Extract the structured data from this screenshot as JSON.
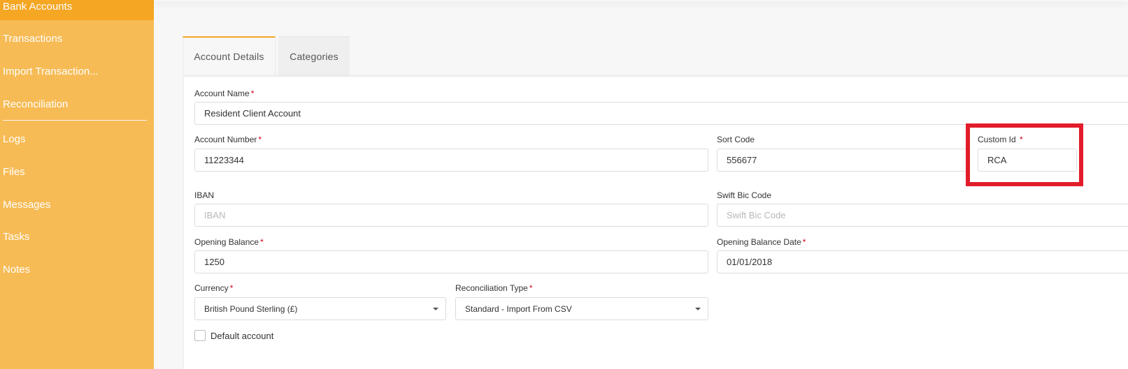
{
  "sidebar": {
    "items": [
      {
        "label": "Bank Accounts"
      },
      {
        "label": "Transactions"
      },
      {
        "label": "Import Transaction..."
      },
      {
        "label": "Reconciliation"
      },
      {
        "label": "Logs"
      },
      {
        "label": "Files"
      },
      {
        "label": "Messages"
      },
      {
        "label": "Tasks"
      },
      {
        "label": "Notes"
      }
    ]
  },
  "tabs": [
    {
      "label": "Account Details"
    },
    {
      "label": "Categories"
    }
  ],
  "form": {
    "required_mark": "*",
    "account_name": {
      "label": "Account Name",
      "value": "Resident Client Account"
    },
    "account_number": {
      "label": "Account Number",
      "value": "11223344"
    },
    "sort_code": {
      "label": "Sort Code",
      "value": "556677"
    },
    "custom_id": {
      "label": "Custom Id",
      "value": "RCA"
    },
    "iban": {
      "label": "IBAN",
      "placeholder": "IBAN"
    },
    "swift": {
      "label": "Swift Bic Code",
      "placeholder": "Swift Bic Code"
    },
    "opening_balance": {
      "label": "Opening Balance",
      "value": "1250"
    },
    "opening_balance_date": {
      "label": "Opening Balance Date",
      "value": "01/01/2018"
    },
    "currency": {
      "label": "Currency",
      "value": "British Pound Sterling (£)"
    },
    "reconciliation_type": {
      "label": "Reconciliation Type",
      "value": "Standard - Import From CSV"
    },
    "default_account": {
      "label": "Default account",
      "checked": false
    }
  },
  "colors": {
    "sidebar_bg": "#f7bb55",
    "sidebar_active": "#f5a623",
    "required": "#d0021b",
    "highlight": "#e21c2a"
  }
}
